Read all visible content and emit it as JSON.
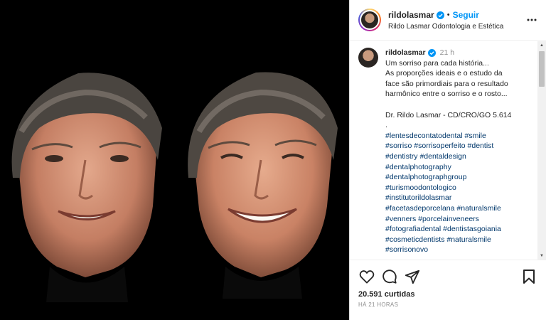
{
  "header": {
    "username": "rildolasmar",
    "separator": "•",
    "follow_label": "Seguir",
    "subtitle": "Rildo Lasmar Odontologia e Estética"
  },
  "caption": {
    "username": "rildolasmar",
    "time": "21 h",
    "lines": [
      "Um sorriso para cada história...",
      "As proporções ideais e o estudo da",
      "face são primordiais para o resultado",
      "harmônico entre o sorriso e o rosto...",
      "",
      "Dr. Rildo Lasmar - CD/CRO/GO 5.614",
      "."
    ],
    "hashtags": [
      "#lentesdecontatodental #smile",
      "#sorriso #sorrisoperfeito #dentist",
      "#dentistry #dentaldesign",
      "#dentalphotography",
      "#dentalphotographgroup",
      "#turismoodontologico",
      "#institutorildolasmar",
      "#facetasdeporcelana #naturalsmile",
      "#venners #porcelainveneers",
      "#fotografiadental #dentistasgoiania",
      "#cosmeticdentists #naturalsmile",
      "#sorrisonovo"
    ]
  },
  "stats": {
    "likes": "20.591 curtidas",
    "posted": "HÁ 21 HORAS"
  },
  "icons": {
    "verified": "verified-badge-icon",
    "more": "more-options-icon",
    "like": "heart-icon",
    "comment": "comment-icon",
    "share": "share-icon",
    "save": "bookmark-icon"
  },
  "colors": {
    "accent": "#0095f6",
    "hashtag": "#00376b",
    "muted": "#8e8e8e",
    "text": "#262626"
  }
}
